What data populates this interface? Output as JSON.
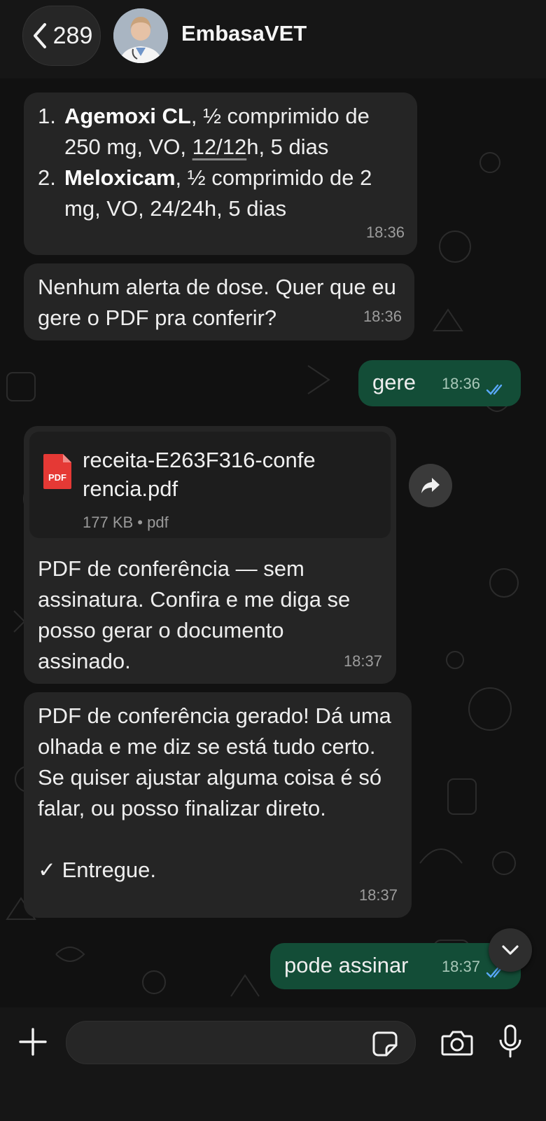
{
  "header": {
    "back_count": "289",
    "contact_name": "EmbasaVET"
  },
  "messages": {
    "m1": {
      "items": [
        {
          "num": "1.",
          "name": "Agemoxi CL",
          "pre": ", ½ comprimido de 250 mg, VO, ",
          "underlined": "12/12",
          "post": "h, 5 dias"
        },
        {
          "num": "2.",
          "name": "Meloxicam",
          "pre": ", ½ comprimido de 2 mg, VO, 24/24h, 5 dias",
          "underlined": "",
          "post": ""
        }
      ],
      "time": "18:36"
    },
    "m2": {
      "text": "Nenhum alerta de dose. Quer que eu gere o PDF pra conferir?",
      "time": "18:36"
    },
    "m3": {
      "text": "gere",
      "time": "18:36"
    },
    "m4": {
      "file_name": "receita-E263F316-conferencia.pdf",
      "file_meta": "177 KB • pdf",
      "pdf_badge": "PDF",
      "caption": "PDF de conferência — sem assinatura. Confira e me diga se posso gerar o documento assinado.",
      "time": "18:37"
    },
    "m5": {
      "text": "PDF de conferência gerado! Dá uma olhada e me diz se está tudo certo. Se quiser ajustar alguma coisa é só falar, ou posso finalizar direto.",
      "delivered": "✓ Entregue.",
      "time": "18:37"
    },
    "m6": {
      "text": "pode assinar",
      "time": "18:37"
    }
  },
  "colors": {
    "incoming_bubble": "#252525",
    "outgoing_bubble": "#134d37",
    "read_ticks": "#5aa9ff",
    "pdf_red": "#e53935"
  },
  "icons": [
    "chevron-left-icon",
    "avatar",
    "forward-icon",
    "pdf-file-icon",
    "read-receipt-icon",
    "chevron-down-icon",
    "plus-icon",
    "sticker-icon",
    "camera-icon",
    "microphone-icon"
  ]
}
